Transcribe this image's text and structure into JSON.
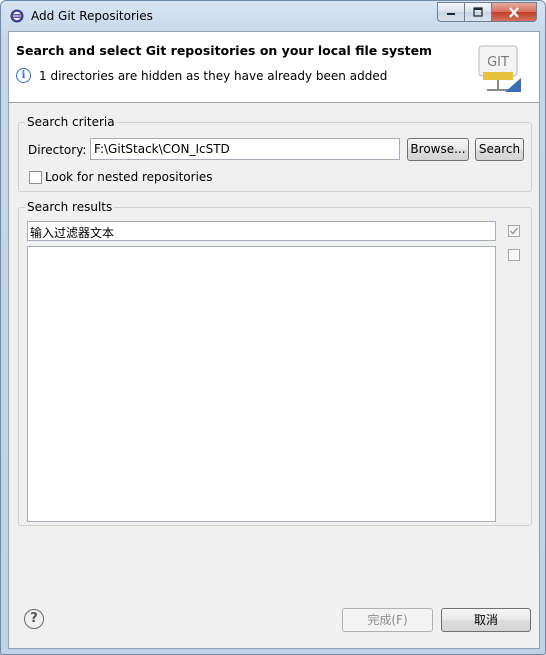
{
  "window": {
    "title": "Add Git Repositories",
    "icon": "eclipse-icon"
  },
  "header": {
    "title": "Search and select Git repositories on your local file system",
    "info_icon": "info-icon",
    "info_text": "1 directories are hidden as they have already been added",
    "logo_text": "GIT"
  },
  "search_criteria": {
    "label": "Search criteria",
    "directory_label": "Directory:",
    "directory_value": "F:\\GitStack\\CON_IcSTD",
    "browse_label": "Browse...",
    "search_label": "Search",
    "nested_label": "Look for nested repositories",
    "nested_checked": false
  },
  "search_results": {
    "label": "Search results",
    "filter_placeholder": "输入过滤器文本",
    "items": []
  },
  "footer": {
    "help_icon": "help-icon",
    "finish_label": "完成(F)",
    "cancel_label": "取消"
  },
  "colors": {
    "title_bar": "#c5d6ea",
    "close_button": "#c0402a",
    "client_bg": "#f0f0f0",
    "info_icon": "#2f6fc4"
  }
}
